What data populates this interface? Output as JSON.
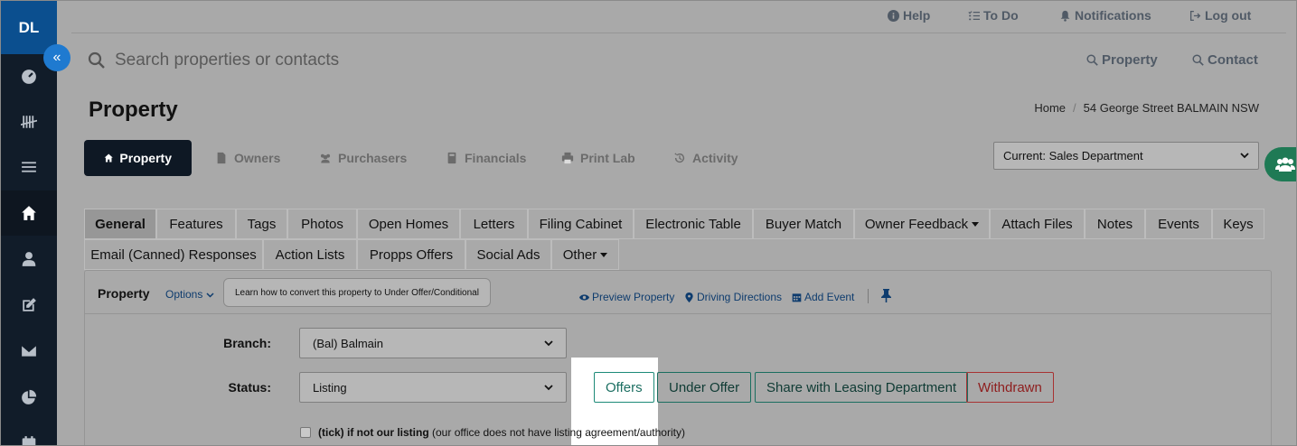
{
  "sidebar": {
    "logo": "DL",
    "items": [
      {
        "icon": "dashboard-icon"
      },
      {
        "icon": "tally-icon"
      },
      {
        "icon": "list-icon"
      },
      {
        "icon": "home-icon",
        "active": true
      },
      {
        "icon": "person-icon"
      },
      {
        "icon": "edit-icon"
      },
      {
        "icon": "mail-icon"
      },
      {
        "icon": "pie-chart-icon"
      },
      {
        "icon": "calendar-icon"
      }
    ],
    "collapse_label": "«"
  },
  "topbar": {
    "help": "Help",
    "todo": "To Do",
    "notifications": "Notifications",
    "logout": "Log out"
  },
  "search": {
    "placeholder": "Search properties or contacts",
    "scope_property": "Property",
    "scope_contact": "Contact"
  },
  "page": {
    "title": "Property",
    "breadcrumb": [
      "Home",
      "54 George Street BALMAIN NSW"
    ]
  },
  "main_tabs": [
    "Property",
    "Owners",
    "Purchasers",
    "Financials",
    "Print Lab",
    "Activity"
  ],
  "department_select": "Current: Sales Department",
  "sub_tabs_row1": [
    "General",
    "Features",
    "Tags",
    "Photos",
    "Open Homes",
    "Letters",
    "Filing Cabinet",
    "Electronic Table",
    "Buyer Match",
    "Owner Feedback",
    "Attach Files",
    "Notes",
    "Events",
    "Keys"
  ],
  "sub_tabs_row2": [
    "Email (Canned) Responses",
    "Action Lists",
    "Propps Offers",
    "Social Ads",
    "Other"
  ],
  "panel": {
    "title": "Property",
    "options": "Options",
    "learn_button": "Learn how to convert this property to Under Offer/Conditional",
    "preview": "Preview Property",
    "directions": "Driving Directions",
    "add_event": "Add Event"
  },
  "form": {
    "branch_label": "Branch:",
    "branch_value": "(Bal) Balmain",
    "status_label": "Status:",
    "status_value": "Listing",
    "buttons": {
      "offers": "Offers",
      "under_offer": "Under Offer",
      "share": "Share with Leasing Department",
      "withdrawn": "Withdrawn"
    },
    "checkbox_prefix": "(tick)",
    "checkbox_bold": "if not our listing",
    "checkbox_suffix": "(our office does not have listing agreement/authority)"
  }
}
